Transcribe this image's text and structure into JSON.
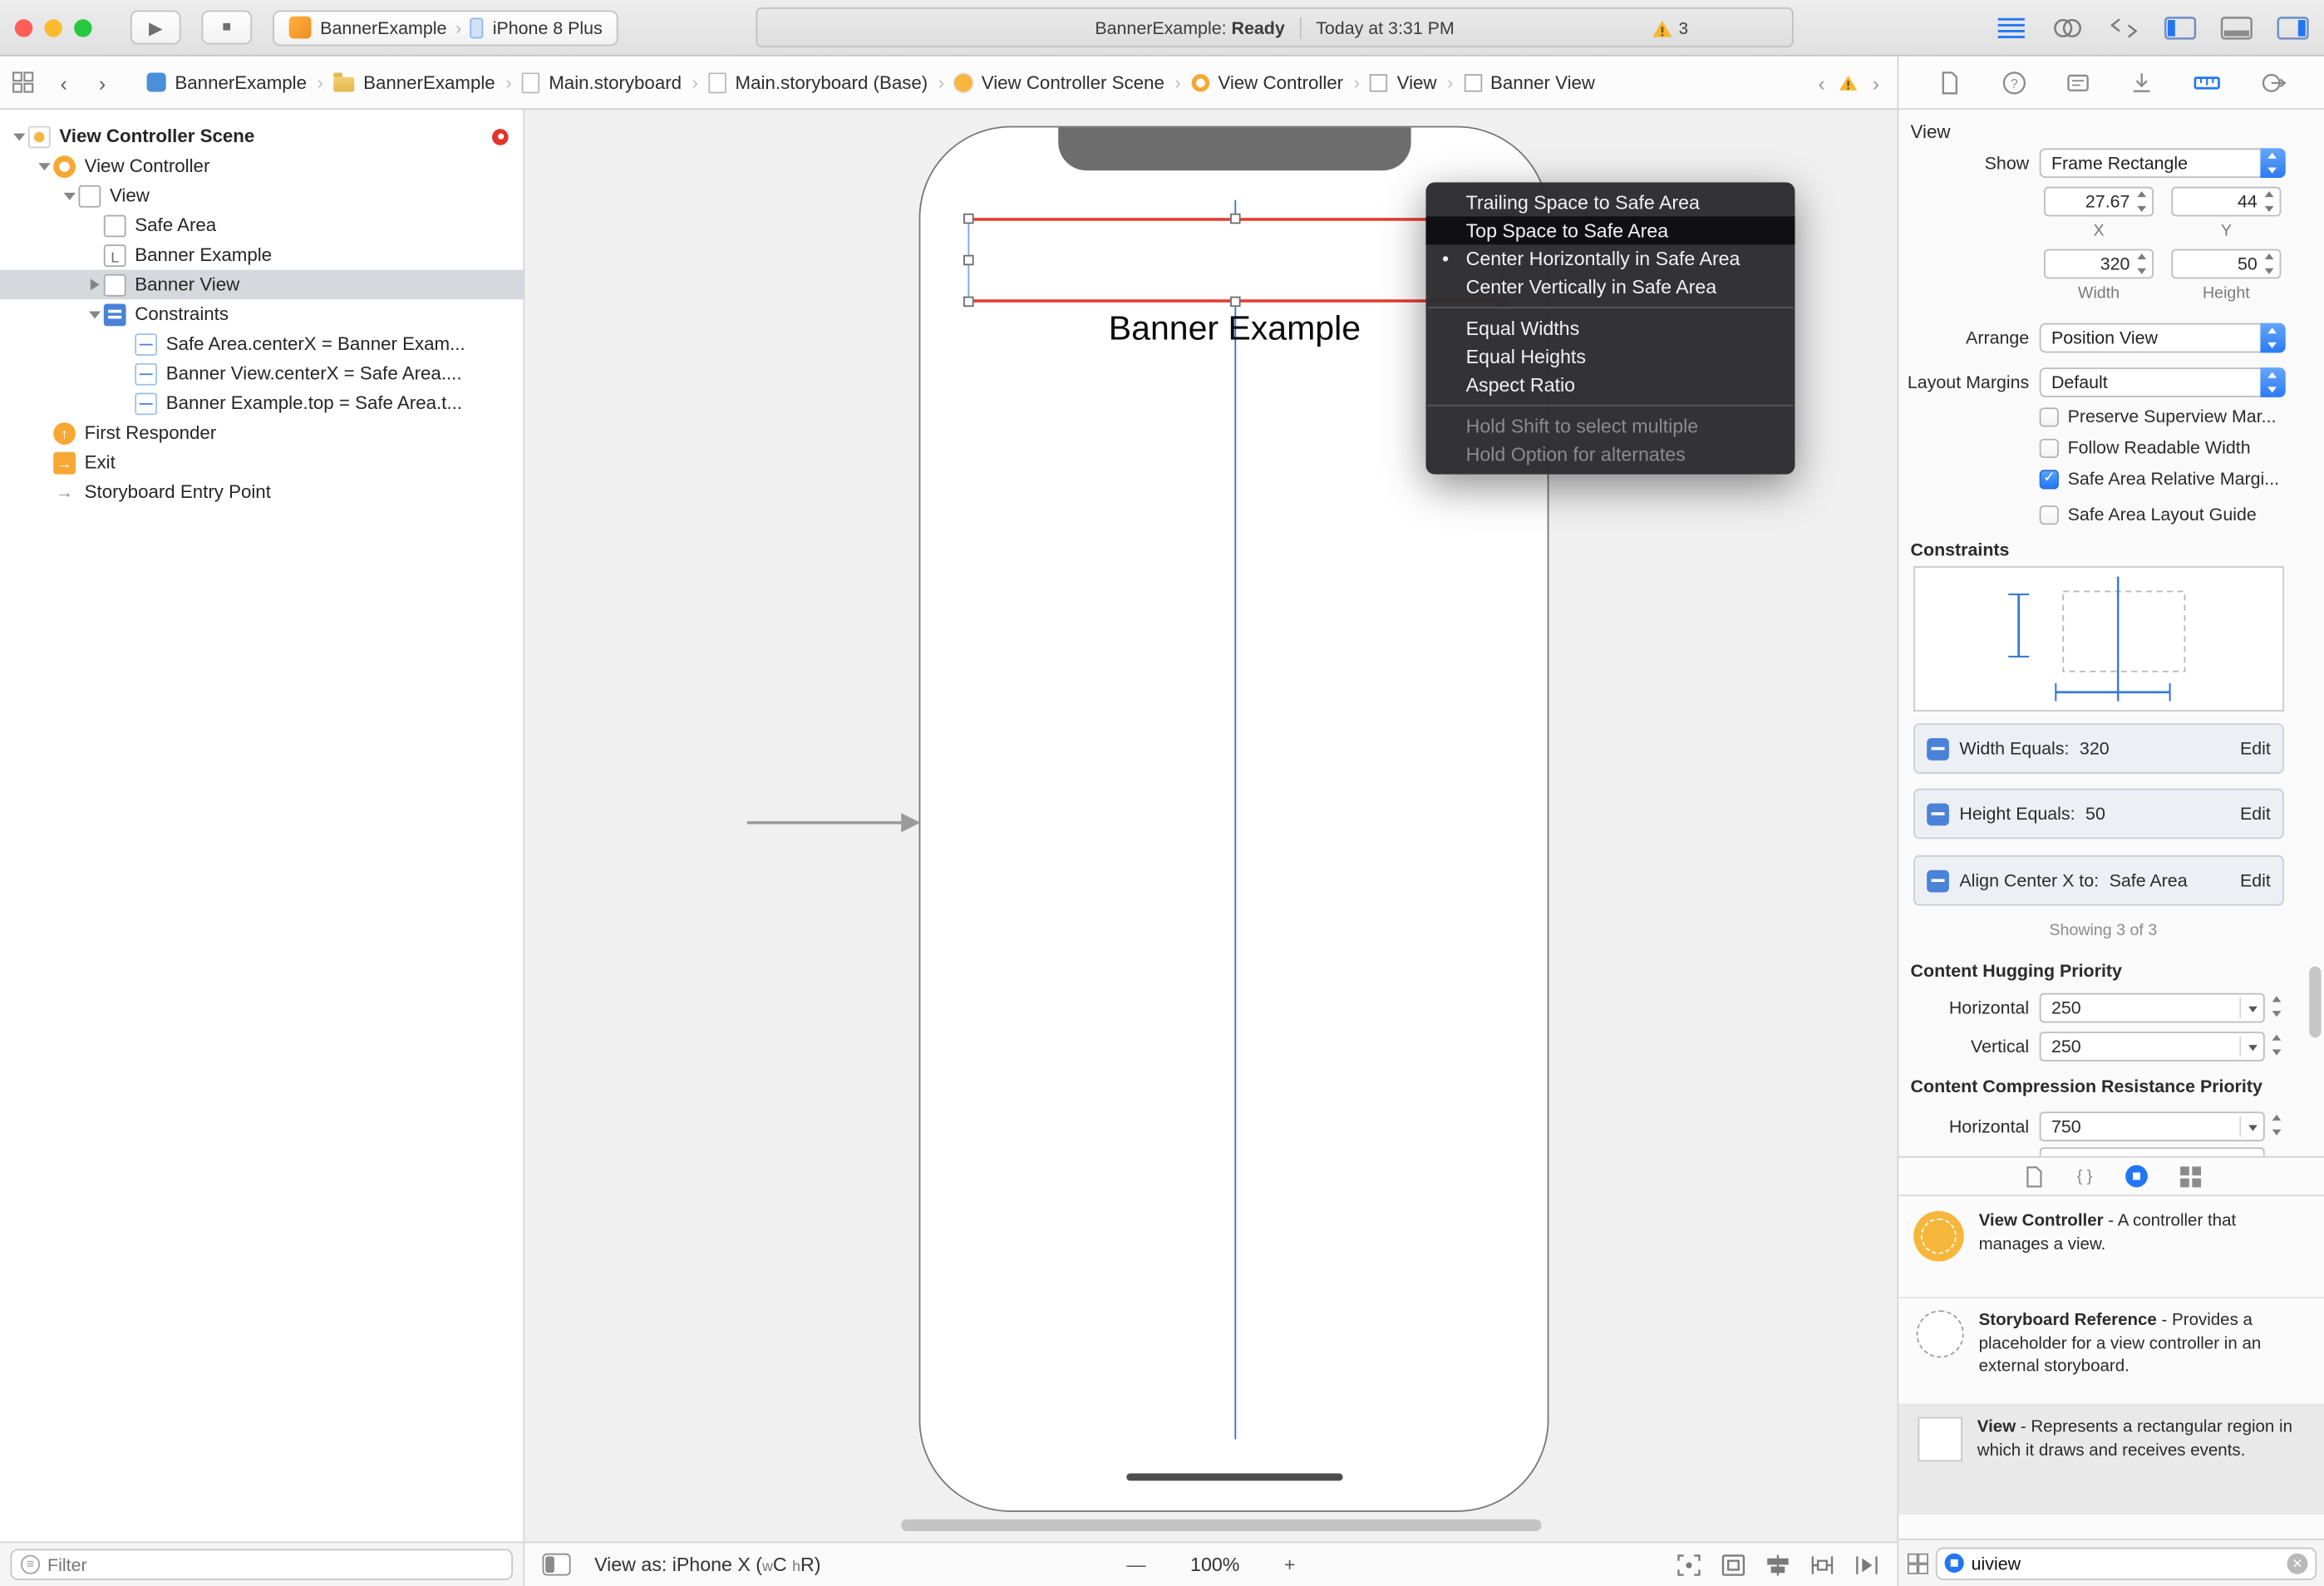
{
  "toolbar": {
    "run_glyph": "▶",
    "stop_glyph": "■",
    "chevron": "›",
    "scheme_app": "BannerExample",
    "scheme_device": "iPhone 8 Plus",
    "status_project": "BannerExample:",
    "status_state": "Ready",
    "status_time": "Today at 3:31 PM",
    "warning_count": "3"
  },
  "jumpbar": {
    "back": "‹",
    "forward": "›",
    "separator": "›",
    "prev_issue": "‹",
    "next_issue": "›",
    "items": [
      {
        "icon": "project-icon",
        "label": "BannerExample"
      },
      {
        "icon": "folder-icon",
        "label": "BannerExample"
      },
      {
        "icon": "storyboard-icon",
        "label": "Main.storyboard"
      },
      {
        "icon": "storyboard-icon",
        "label": "Main.storyboard (Base)"
      },
      {
        "icon": "scene-icon",
        "label": "View Controller Scene"
      },
      {
        "icon": "view-controller-icon",
        "label": "View Controller"
      },
      {
        "icon": "view-icon",
        "label": "View"
      },
      {
        "icon": "view-icon",
        "label": "Banner View"
      }
    ]
  },
  "outline": {
    "items": [
      {
        "icon": "scene-icon",
        "label": "View Controller Scene"
      },
      {
        "icon": "view-controller-icon",
        "label": "View Controller"
      },
      {
        "icon": "view-icon",
        "label": "View"
      },
      {
        "icon": "view-icon",
        "label": "Safe Area"
      },
      {
        "icon": "label-icon",
        "label": "Banner Example"
      },
      {
        "icon": "view-icon",
        "label": "Banner View"
      },
      {
        "icon": "constraints-icon",
        "label": "Constraints"
      },
      {
        "icon": "constraint-icon",
        "label": "Safe Area.centerX = Banner Exam..."
      },
      {
        "icon": "constraint-icon",
        "label": "Banner View.centerX = Safe Area...."
      },
      {
        "icon": "constraint-icon",
        "label": "Banner Example.top = Safe Area.t..."
      },
      {
        "icon": "first-responder-icon",
        "label": "First Responder"
      },
      {
        "icon": "exit-icon",
        "label": "Exit"
      },
      {
        "icon": "entry-point-icon",
        "label": "Storyboard Entry Point"
      }
    ],
    "selected_item": "Banner View",
    "filter_placeholder": "Filter"
  },
  "canvas": {
    "banner_label": "Banner Example",
    "menu": {
      "highlighted": "Top Space to Safe Area",
      "items": [
        "Trailing Space to Safe Area",
        "Top Space to Safe Area",
        "Center Horizontally in Safe Area",
        "Center Vertically in Safe Area",
        "Equal Widths",
        "Equal Heights",
        "Aspect Ratio",
        "Hold Shift to select multiple",
        "Hold Option for alternates"
      ]
    },
    "bottombar": {
      "view_as_prefix": "View as: iPhone X (",
      "w_small": "w",
      "w_class": "C",
      "h_small": "h",
      "h_class": "R",
      "view_as_suffix": ")",
      "zoom_out": "—",
      "zoom_level": "100%",
      "zoom_in": "+"
    }
  },
  "inspector": {
    "title": "View",
    "show_label": "Show",
    "show_value": "Frame Rectangle",
    "fields": {
      "x": "27.67",
      "y": "44",
      "width": "320",
      "height": "50",
      "x_label": "X",
      "y_label": "Y",
      "width_label": "Width",
      "height_label": "Height"
    },
    "arrange_label": "Arrange",
    "arrange_value": "Position View",
    "layout_margins_label": "Layout Margins",
    "layout_margins_value": "Default",
    "checkboxes": [
      {
        "label": "Preserve Superview Mar...",
        "checked": false
      },
      {
        "label": "Follow Readable Width",
        "checked": false
      },
      {
        "label": "Safe Area Relative Margi...",
        "checked": true
      },
      {
        "label": "Safe Area Layout Guide",
        "checked": false
      }
    ],
    "constraints_header": "Constraints",
    "constraints": [
      {
        "label": "Width Equals:",
        "value": "320",
        "action": "Edit"
      },
      {
        "label": "Height Equals:",
        "value": "50",
        "action": "Edit"
      },
      {
        "label": "Align Center X to:",
        "value": "Safe Area",
        "action": "Edit"
      }
    ],
    "showing": "Showing 3 of 3",
    "hugging_header": "Content Hugging Priority",
    "hugging_rows": [
      {
        "label": "Horizontal",
        "value": "250"
      },
      {
        "label": "Vertical",
        "value": "250"
      }
    ],
    "compression_header": "Content Compression Resistance Priority",
    "compression_rows": [
      {
        "label": "Horizontal",
        "value": "750"
      }
    ]
  },
  "library": {
    "items": [
      {
        "title": "View Controller",
        "desc": " - A controller that manages a view."
      },
      {
        "title": "Storyboard Reference",
        "desc": " - Provides a placeholder for a view controller in an external storyboard."
      },
      {
        "title": "View",
        "desc": " - Represents a rectangular region in which it draws and receives events."
      }
    ],
    "filter_value": "uiview"
  }
}
